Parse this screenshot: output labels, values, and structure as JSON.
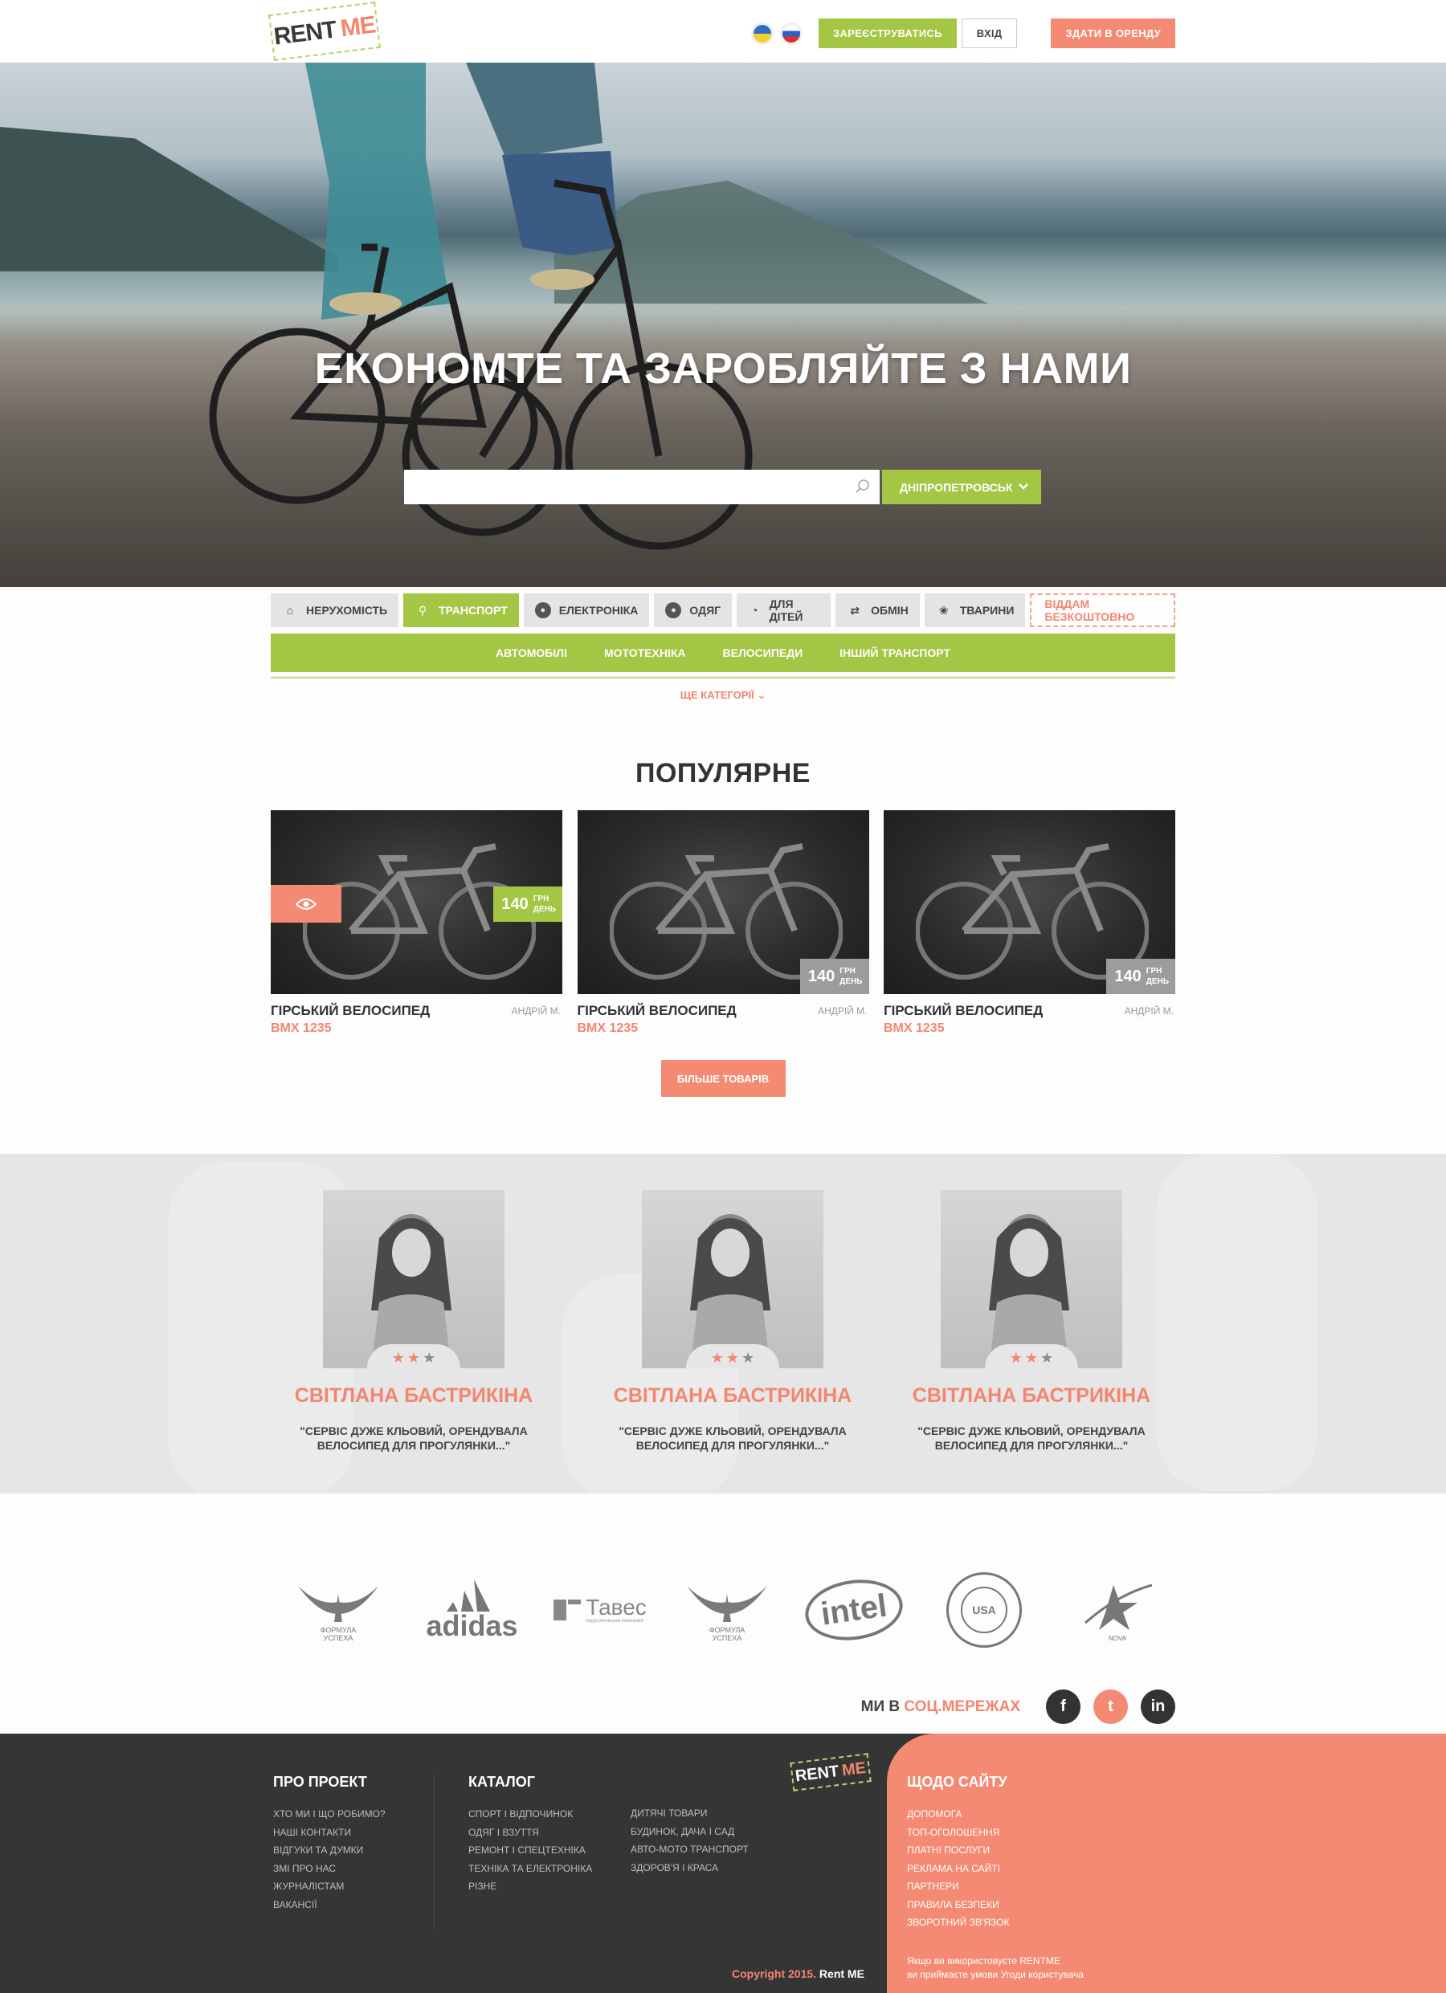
{
  "header": {
    "logo_rent": "RENT",
    "logo_me": "ME",
    "register": "ЗАРЕЄСТРУВАТИСЬ",
    "login": "ВХІД",
    "rent_out": "ЗДАТИ В ОРЕНДУ"
  },
  "hero": {
    "title": "ЕКОНОМТЕ ТА ЗАРОБЛЯЙТЕ З НАМИ",
    "search_placeholder": "",
    "city": "ДНІПРОПЕТРОВСЬК"
  },
  "categories": [
    {
      "label": "НЕРУХОМІСТЬ",
      "icon": "home-icon",
      "glyph": "⌂",
      "active": false
    },
    {
      "label": "ТРАНСПОРТ",
      "icon": "bike-icon",
      "glyph": "⚲",
      "active": true
    },
    {
      "label": "ЕЛЕКТРОНІКА",
      "icon": "electronics-icon",
      "glyph": "●",
      "active": false
    },
    {
      "label": "ОДЯГ",
      "icon": "clothes-icon",
      "glyph": "●",
      "active": false
    },
    {
      "label": "ДЛЯ ДІТЕЙ",
      "icon": "stroller-icon",
      "glyph": "◔",
      "active": false
    },
    {
      "label": "ОБМІН",
      "icon": "shuffle-icon",
      "glyph": "⇄",
      "active": false
    },
    {
      "label": "ТВАРИНИ",
      "icon": "paw-icon",
      "glyph": "❀",
      "active": false
    }
  ],
  "free_tab": "ВІДДАМ БЕЗКОШТОВНО",
  "subcategories": [
    "АВТОМОБІЛІ",
    "МОТОТЕХНІКА",
    "ВЕЛОСИПЕДИ",
    "ІНШИЙ ТРАНСПОРТ"
  ],
  "more_categories": "ЩЕ КАТЕГОРІЇ",
  "popular": {
    "title": "ПОПУЛЯРНЕ",
    "products": [
      {
        "name": "ГІРСЬКИЙ ВЕЛОСИПЕД",
        "owner": "АНДРІЙ М.",
        "code": "BMX 1235",
        "price": "140",
        "unit1": "ГРН",
        "unit2": "ДЕНЬ"
      },
      {
        "name": "ГІРСЬКИЙ ВЕЛОСИПЕД",
        "owner": "АНДРІЙ М.",
        "code": "BMX 1235",
        "price": "140",
        "unit1": "ГРН",
        "unit2": "ДЕНЬ"
      },
      {
        "name": "ГІРСЬКИЙ ВЕЛОСИПЕД",
        "owner": "АНДРІЙ М.",
        "code": "BMX 1235",
        "price": "140",
        "unit1": "ГРН",
        "unit2": "ДЕНЬ"
      }
    ],
    "more_button": "БІЛЬШЕ ТОВАРІВ"
  },
  "testimonials": [
    {
      "name": "СВІТЛАНА БАСТРИКІНА",
      "quote_line1": "\"СЕРВІС ДУЖЕ КЛЬОВИЙ, ОРЕНДУВАЛА",
      "quote_line2": "ВЕЛОСИПЕД ДЛЯ ПРОГУЛЯНКИ...\"",
      "rating": 2,
      "max_rating": 3
    },
    {
      "name": "СВІТЛАНА БАСТРИКІНА",
      "quote_line1": "\"СЕРВІС ДУЖЕ КЛЬОВИЙ, ОРЕНДУВАЛА",
      "quote_line2": "ВЕЛОСИПЕД ДЛЯ ПРОГУЛЯНКИ...\"",
      "rating": 2,
      "max_rating": 3
    },
    {
      "name": "СВІТЛАНА БАСТРИКІНА",
      "quote_line1": "\"СЕРВІС ДУЖЕ КЛЬОВИЙ, ОРЕНДУВАЛА",
      "quote_line2": "ВЕЛОСИПЕД ДЛЯ ПРОГУЛЯНКИ...\"",
      "rating": 2,
      "max_rating": 3
    }
  ],
  "partners": {
    "formula_line1": "ФОРМУЛА",
    "formula_line2": "УСПЕХА",
    "adidas": "adidas",
    "taves": "Тавес",
    "taves_sub": "педагогическая компания",
    "intel": "intel",
    "ssa": "USA",
    "nova": "NOVA"
  },
  "social": {
    "prefix": "МИ В ",
    "highlight": "СОЦ.МЕРЕЖАХ",
    "fb": "f",
    "tw": "t",
    "in": "in"
  },
  "footer": {
    "about_title": "ПРО ПРОЕКТ",
    "about_items": [
      "ХТО МИ І ЩО РОБИМО?",
      "НАШІ КОНТАКТИ",
      "ВІДГУКИ ТА ДУМКИ",
      "ЗМІ ПРО НАС",
      "ЖУРНАЛІСТАМ",
      "ВАКАНСІЇ"
    ],
    "catalog_title": "КАТАЛОГ",
    "catalog_col1": [
      "СПОРТ І ВІДПОЧИНОК",
      "ОДЯГ І ВЗУТТЯ",
      "РЕМОНТ І СПЕЦТЕХНІКА",
      "ТЕХНІКА ТА ЕЛЕКТРОНІКА",
      "РІЗНЕ"
    ],
    "catalog_col2": [
      "ДИТЯЧІ ТОВАРИ",
      "БУДИНОК, ДАЧА І САД",
      "АВТО-МОТО ТРАНСПОРТ",
      "ЗДОРОВ'Я І КРАСА"
    ],
    "site_title": "ЩОДО САЙТУ",
    "site_items": [
      "ДОПОМОГА",
      "ТОП-ОГОЛОШЕННЯ",
      "ПЛАТНІ ПОСЛУГИ",
      "РЕКЛАМА НА САЙТІ",
      "ПАРТНЕРИ",
      "ПРАВИЛА БЕЗПЕКИ",
      "ЗВОРОТНИЙ ЗВ'ЯЗОК"
    ],
    "copyright": "Copyright 2015.",
    "copyright_brand": "Rent ME",
    "agree_line1": "Якщо ви використовуєте RENTME",
    "agree_line2": "ви приймаєте умови Угоди користувача"
  },
  "colors": {
    "green": "#a3c644",
    "salmon": "#f48a73",
    "dark": "#353535"
  }
}
